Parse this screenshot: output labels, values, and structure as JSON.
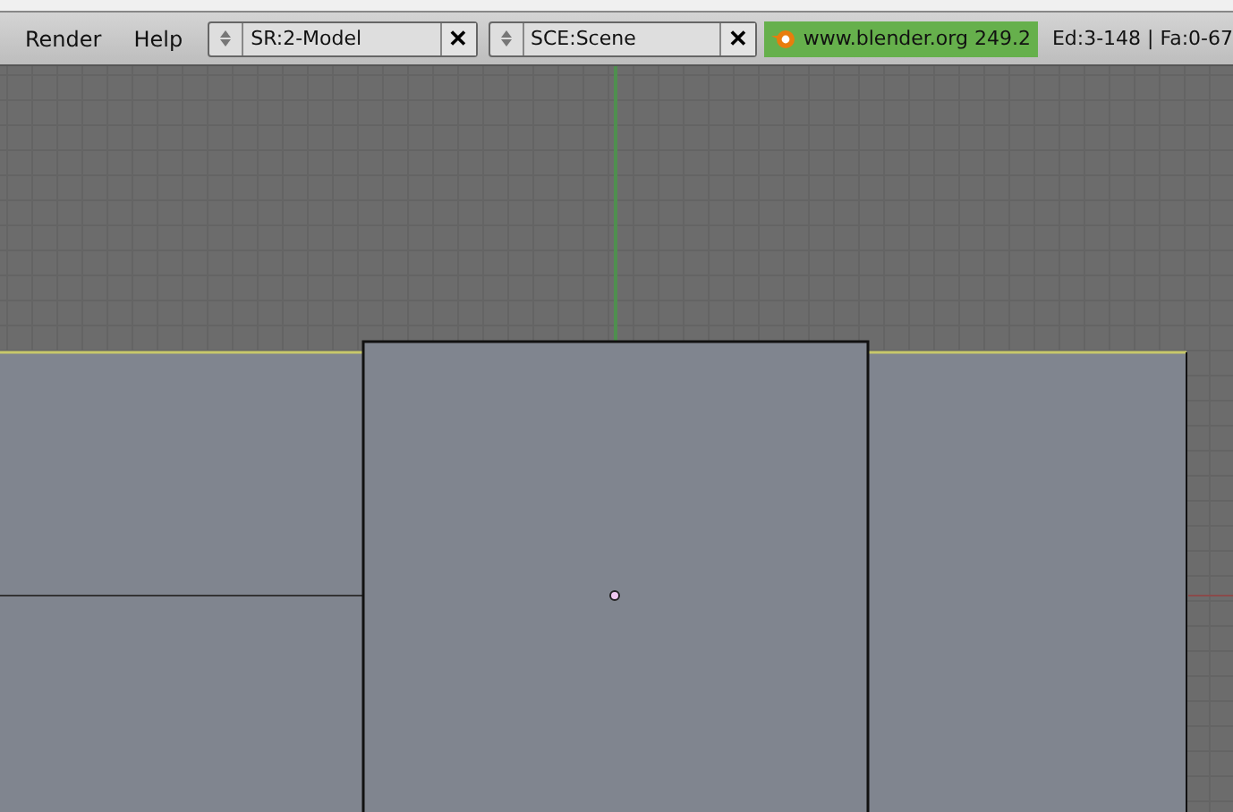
{
  "menu": [
    "Render",
    "Help"
  ],
  "fields": [
    {
      "value": "SR:2-Model",
      "close": "✕"
    },
    {
      "value": "SCE:Scene",
      "close": "✕"
    }
  ],
  "version": "www.blender.org 249.2",
  "stats": "Ed:3-148 | Fa:0-67"
}
